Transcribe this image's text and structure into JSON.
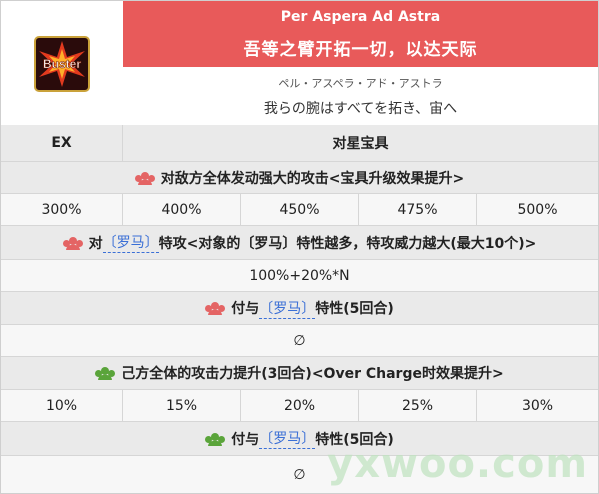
{
  "noble_phantasm": {
    "name_en": "Per Aspera Ad Astra",
    "name_cn": "吾等之臂开拓一切，以达天际",
    "ruby": "ペル・アスペラ・アド・アストラ",
    "name_jp": "我らの腕はすべてを拓き、宙へ",
    "card_icon": "buster-card-icon",
    "card_label": "Buster",
    "rank": "EX",
    "type": "对星宝具"
  },
  "colors": {
    "header_red": "#e85a5a",
    "enemy_icon": "#e46464",
    "ally_icon": "#5aa43a",
    "trait_link": "#3a6fd6"
  },
  "effects": [
    {
      "icon": "enemy-group-icon",
      "text": "对敌方全体发动强大的攻击<宝具升级效果提升>",
      "values": [
        "300%",
        "400%",
        "450%",
        "475%",
        "500%"
      ]
    },
    {
      "icon": "enemy-group-icon",
      "prefix": "对",
      "trait": "〔罗马〕",
      "suffix": "特攻<对象的〔罗马〕特性越多，特攻威力越大(最大10个)>",
      "value": "100%+20%*N"
    },
    {
      "icon": "enemy-group-icon",
      "prefix": "付与",
      "trait": "〔罗马〕",
      "suffix": "特性(5回合)",
      "value": "∅"
    },
    {
      "icon": "ally-group-icon",
      "text": "己方全体的攻击力提升(3回合)<Over Charge时效果提升>",
      "values": [
        "10%",
        "15%",
        "20%",
        "25%",
        "30%"
      ]
    },
    {
      "icon": "ally-group-icon",
      "prefix": "付与",
      "trait": "〔罗马〕",
      "suffix": "特性(5回合)",
      "value": "∅"
    }
  ],
  "watermark": "yxwoo.com"
}
